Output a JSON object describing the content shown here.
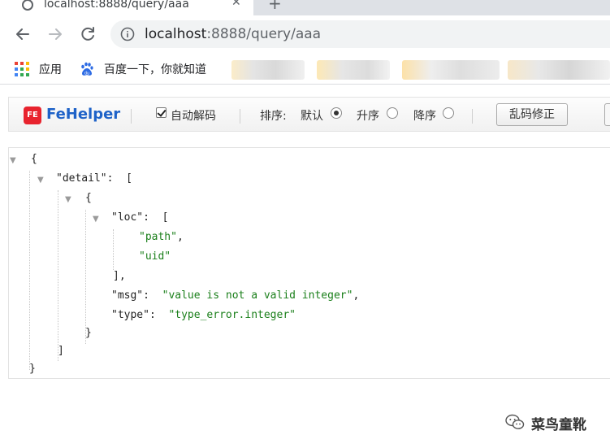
{
  "browser": {
    "tab_title": "localhost:8888/query/aaa",
    "url_host": "localhost",
    "url_path": ":8888/query/aaa",
    "bookmarks": [
      "应用",
      "百度一下，你就知道"
    ]
  },
  "fehelper": {
    "brand": "FeHelper",
    "logo_text": "FE",
    "auto_decode_label": "自动解码",
    "auto_decode_checked": true,
    "sort_label": "排序:",
    "sort_default": "默认",
    "sort_asc": "升序",
    "sort_desc": "降序",
    "sort_selected": "默认",
    "fix_button": "乱码修正"
  },
  "json_view": {
    "open_brace": "{",
    "close_brace": "}",
    "open_bracket": "[",
    "close_bracket": "]",
    "close_bracket_comma": "],",
    "key_detail": "\"detail\"",
    "key_loc": "\"loc\"",
    "key_msg": "\"msg\"",
    "key_type": "\"type\"",
    "val_path": "\"path\"",
    "val_uid": "\"uid\"",
    "val_msg": "\"value is not a valid integer\"",
    "val_type": "\"type_error.integer\"",
    "colon": ":",
    "comma": ","
  },
  "watermark": "菜鸟童靴",
  "colors": {
    "tab_bg": "#dee1e6",
    "omnibox_bg": "#f1f3f4",
    "fehelper_blue": "#1e62c8",
    "fe_red": "#e8232e",
    "json_string": "#1a7f1a"
  },
  "icons": [
    "tab-favicon-icon",
    "close-icon",
    "plus-icon",
    "back-arrow-icon",
    "forward-arrow-icon",
    "reload-icon",
    "info-icon",
    "apps-grid-icon",
    "baidu-paw-icon",
    "collapse-triangle-icon",
    "wechat-icon"
  ]
}
